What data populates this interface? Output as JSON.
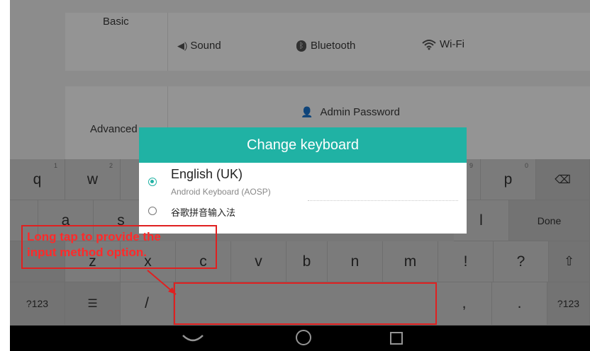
{
  "settings": {
    "basic_label": "Basic",
    "advanced_label": "Advanced",
    "sound_label": "Sound",
    "bluetooth_label": "Bluetooth",
    "wifi_label": "Wi-Fi",
    "admin_password_label": "Admin Password"
  },
  "dialog": {
    "title": "Change keyboard",
    "options": [
      {
        "label": "English (UK)",
        "sublabel": "Android Keyboard (AOSP)",
        "selected": true
      },
      {
        "label": "谷歌拼音输入法",
        "selected": false
      }
    ]
  },
  "keyboard": {
    "row1": [
      {
        "key": "q",
        "hint": "1"
      },
      {
        "key": "w",
        "hint": "2"
      },
      {
        "key": "p",
        "hint": "0"
      },
      {
        "hint": "9"
      }
    ],
    "row2": [
      "a",
      "s",
      "l"
    ],
    "done_label": "Done",
    "row3": [
      "z",
      "x",
      "c",
      "v",
      "b",
      "n",
      "m",
      "!",
      "?"
    ],
    "row4": {
      "sym_label": "?123",
      "slash": "/",
      "comma": ",",
      "period": ".",
      "sym_label_right": "?123"
    }
  },
  "annotation": {
    "text_line1": "Long tap to provide the",
    "text_line2": "input method option."
  },
  "colors": {
    "accent": "#20b2a4",
    "annotation": "#e02020"
  }
}
